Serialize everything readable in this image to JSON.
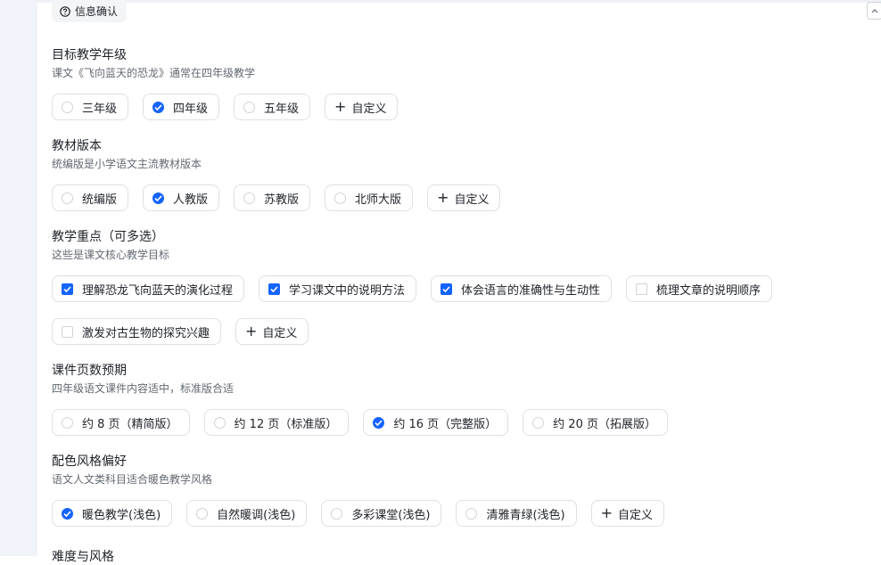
{
  "tag": {
    "label": "信息确认",
    "icon": "question-circle-icon"
  },
  "custom_label": "自定义",
  "sections": [
    {
      "title": "目标教学年级",
      "desc": "课文《飞向蓝天的恐龙》通常在四年级教学",
      "type": "radio",
      "options": [
        {
          "label": "三年级",
          "selected": false
        },
        {
          "label": "四年级",
          "selected": true
        },
        {
          "label": "五年级",
          "selected": false
        }
      ]
    },
    {
      "title": "教材版本",
      "desc": "统编版是小学语文主流教材版本",
      "type": "radio",
      "options": [
        {
          "label": "统编版",
          "selected": false
        },
        {
          "label": "人教版",
          "selected": true
        },
        {
          "label": "苏教版",
          "selected": false
        },
        {
          "label": "北师大版",
          "selected": false
        }
      ]
    },
    {
      "title": "教学重点（可多选）",
      "desc": "这些是课文核心教学目标",
      "type": "checkbox",
      "options": [
        {
          "label": "理解恐龙飞向蓝天的演化过程",
          "selected": true
        },
        {
          "label": "学习课文中的说明方法",
          "selected": true
        },
        {
          "label": "体会语言的准确性与生动性",
          "selected": true
        },
        {
          "label": "梳理文章的说明顺序",
          "selected": false
        },
        {
          "label": "激发对古生物的探究兴趣",
          "selected": false
        }
      ]
    },
    {
      "title": "课件页数预期",
      "desc": "四年级语文课件内容适中，标准版合适",
      "type": "radio",
      "nocustom": true,
      "options": [
        {
          "label": "约 8 页（精简版）",
          "selected": false
        },
        {
          "label": "约 12 页（标准版）",
          "selected": false
        },
        {
          "label": "约 16 页（完整版）",
          "selected": true
        },
        {
          "label": "约 20 页（拓展版）",
          "selected": false
        }
      ]
    },
    {
      "title": "配色风格偏好",
      "desc": "语文人文类科目适合暖色教学风格",
      "type": "radio",
      "options": [
        {
          "label": "暖色教学(浅色)",
          "selected": true
        },
        {
          "label": "自然暖调(浅色)",
          "selected": false
        },
        {
          "label": "多彩课堂(浅色)",
          "selected": false
        },
        {
          "label": "清雅青绿(浅色)",
          "selected": false
        }
      ]
    }
  ],
  "next_section_title": "难度与风格",
  "colors": {
    "accent": "#1664ff",
    "border": "#dee0e3",
    "muted": "#646a73"
  }
}
